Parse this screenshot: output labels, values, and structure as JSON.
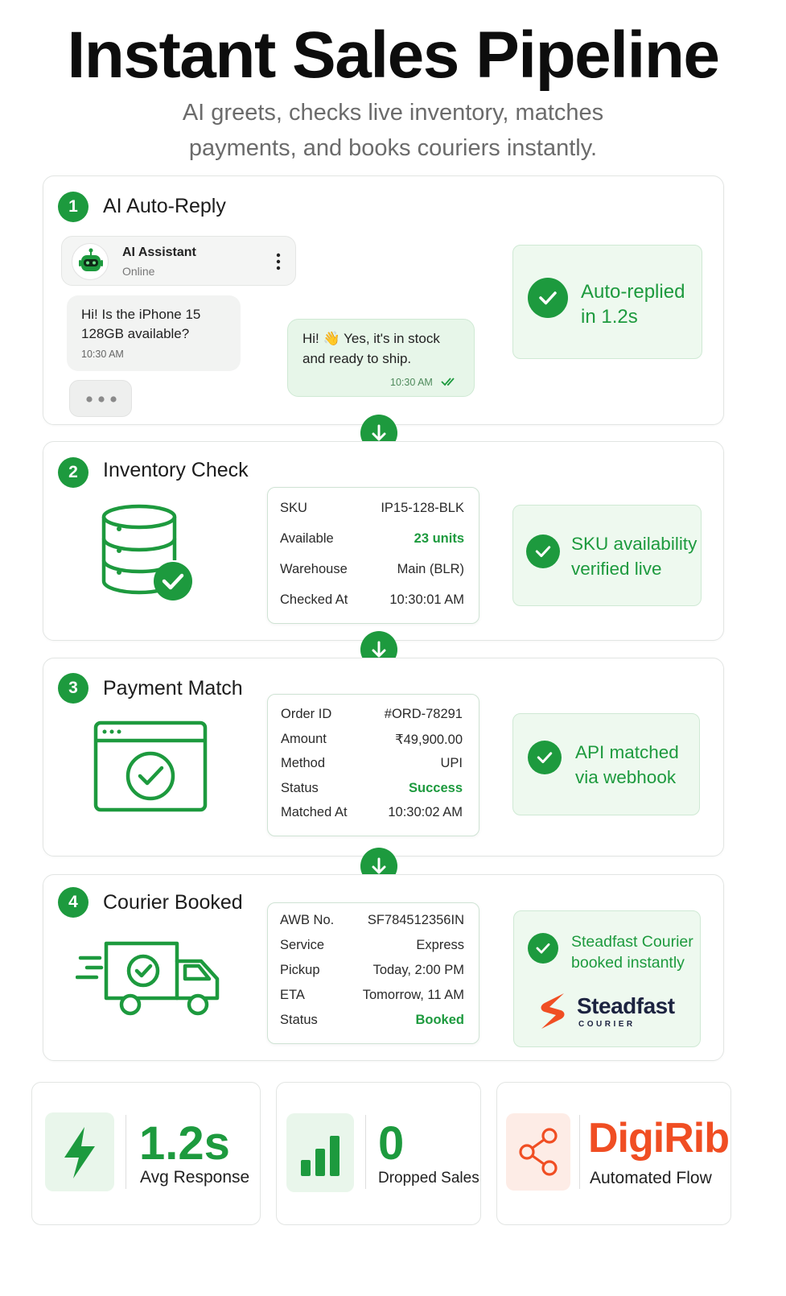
{
  "header": {
    "title": "Instant Sales Pipeline",
    "subtitle_line1": "AI greets, checks live inventory, matches",
    "subtitle_line2": "payments, and books couriers instantly."
  },
  "step1": {
    "num": "1",
    "title": "AI Auto-Reply",
    "chat": {
      "name": "AI Assistant",
      "status": "Online",
      "incoming": {
        "line1": "Hi!  Is the iPhone 15",
        "line2": "128GB available?",
        "time": "10:30 AM"
      },
      "outgoing": {
        "line1": "Hi! 👋  Yes, it's in stock",
        "line2": "and ready to ship.",
        "time": "10:30 AM"
      }
    },
    "badge": {
      "line1": "Auto-replied",
      "line2": "in 1.2s"
    }
  },
  "step2": {
    "num": "2",
    "title": "Inventory Check",
    "rows": [
      {
        "k": "SKU",
        "v": "IP15-128-BLK"
      },
      {
        "k": "Available",
        "v": "23 units"
      },
      {
        "k": "Warehouse",
        "v": "Main (BLR)"
      },
      {
        "k": "Checked At",
        "v": "10:30:01 AM"
      }
    ],
    "badge": {
      "line1": "SKU availability",
      "line2": "verified live"
    }
  },
  "step3": {
    "num": "3",
    "title": "Payment Match",
    "rows": [
      {
        "k": "Order ID",
        "v": "#ORD-78291"
      },
      {
        "k": "Amount",
        "v": "₹49,900.00"
      },
      {
        "k": "Method",
        "v": "UPI"
      },
      {
        "k": "Status",
        "v": "Success"
      },
      {
        "k": "Matched At",
        "v": "10:30:02 AM"
      }
    ],
    "badge": {
      "line1": "API matched",
      "line2": "via webhook"
    }
  },
  "step4": {
    "num": "4",
    "title": "Courier Booked",
    "rows": [
      {
        "k": "AWB No.",
        "v": "SF784512356IN"
      },
      {
        "k": "Service",
        "v": "Express"
      },
      {
        "k": "Pickup",
        "v": "Today, 2:00 PM"
      },
      {
        "k": "ETA",
        "v": "Tomorrow, 11 AM"
      },
      {
        "k": "Status",
        "v": "Booked"
      }
    ],
    "badge": {
      "line1": "Steadfast Courier",
      "line2": "booked instantly"
    },
    "logo": {
      "name": "Steadfast",
      "sub": "COURIER"
    }
  },
  "stats": [
    {
      "value": "1.2s",
      "label": "Avg Response",
      "icon": "lightning-icon"
    },
    {
      "value": "0",
      "label": "Dropped Sales",
      "icon": "bar-chart-icon"
    },
    {
      "value": "DigiRib",
      "label": "Automated Flow",
      "icon": "share-nodes-icon"
    }
  ],
  "colors": {
    "accent": "#1d9a3e",
    "brand_orange": "#f04e23",
    "light_green": "#eef9ef"
  }
}
